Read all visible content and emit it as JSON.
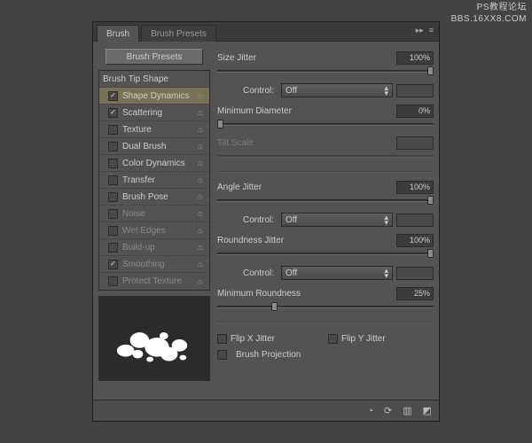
{
  "watermark": {
    "line1": "PS教程论坛",
    "line2": "BBS.16XX8.COM"
  },
  "tabs": {
    "brush": "Brush",
    "presets": "Brush Presets"
  },
  "left": {
    "presets_button": "Brush Presets",
    "items": [
      {
        "label": "Brush Tip Shape",
        "checkbox": false,
        "checked": false,
        "lock": false,
        "selected": false,
        "dim": false
      },
      {
        "label": "Shape Dynamics",
        "checkbox": true,
        "checked": true,
        "lock": true,
        "selected": true,
        "dim": false
      },
      {
        "label": "Scattering",
        "checkbox": true,
        "checked": true,
        "lock": true,
        "selected": false,
        "dim": false
      },
      {
        "label": "Texture",
        "checkbox": true,
        "checked": false,
        "lock": true,
        "selected": false,
        "dim": false
      },
      {
        "label": "Dual Brush",
        "checkbox": true,
        "checked": false,
        "lock": true,
        "selected": false,
        "dim": false
      },
      {
        "label": "Color Dynamics",
        "checkbox": true,
        "checked": false,
        "lock": true,
        "selected": false,
        "dim": false
      },
      {
        "label": "Transfer",
        "checkbox": true,
        "checked": false,
        "lock": true,
        "selected": false,
        "dim": false
      },
      {
        "label": "Brush Pose",
        "checkbox": true,
        "checked": false,
        "lock": true,
        "selected": false,
        "dim": false
      },
      {
        "label": "Noise",
        "checkbox": true,
        "checked": false,
        "lock": true,
        "selected": false,
        "dim": true
      },
      {
        "label": "Wet Edges",
        "checkbox": true,
        "checked": false,
        "lock": true,
        "selected": false,
        "dim": true
      },
      {
        "label": "Build-up",
        "checkbox": true,
        "checked": false,
        "lock": true,
        "selected": false,
        "dim": true
      },
      {
        "label": "Smoothing",
        "checkbox": true,
        "checked": true,
        "lock": true,
        "selected": false,
        "dim": true
      },
      {
        "label": "Protect Texture",
        "checkbox": true,
        "checked": false,
        "lock": true,
        "selected": false,
        "dim": true
      }
    ]
  },
  "right": {
    "size_jitter": {
      "label": "Size Jitter",
      "value": "100%",
      "pos": 100
    },
    "control1": {
      "label": "Control:",
      "value": "Off"
    },
    "min_diameter": {
      "label": "Minimum Diameter",
      "value": "0%",
      "pos": 0
    },
    "tilt_scale": {
      "label": "Tilt Scale",
      "value": "",
      "pos": 0,
      "disabled": true
    },
    "angle_jitter": {
      "label": "Angle Jitter",
      "value": "100%",
      "pos": 100
    },
    "control2": {
      "label": "Control:",
      "value": "Off"
    },
    "roundness_jitter": {
      "label": "Roundness Jitter",
      "value": "100%",
      "pos": 100
    },
    "control3": {
      "label": "Control:",
      "value": "Off"
    },
    "min_roundness": {
      "label": "Minimum Roundness",
      "value": "25%",
      "pos": 25
    },
    "flip_x": "Flip X Jitter",
    "flip_y": "Flip Y Jitter",
    "brush_projection": "Brush Projection"
  }
}
